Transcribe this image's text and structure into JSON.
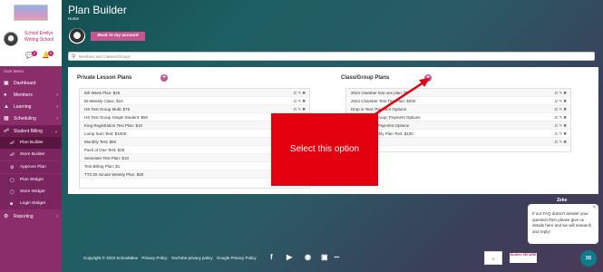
{
  "sidebar": {
    "school_name": "School Emilys Writing School",
    "messages_count": "0",
    "notifications_count": "0",
    "menu_label": "User Menu",
    "items": [
      {
        "label": "Dashboard",
        "icon": "dashboard-icon"
      },
      {
        "label": "Members",
        "icon": "users-icon"
      },
      {
        "label": "Learning",
        "icon": "graduation-cap-icon"
      },
      {
        "label": "Scheduling",
        "icon": "calendar-icon"
      },
      {
        "label": "Student Billing",
        "icon": "cart-icon"
      },
      {
        "label": "Reporting",
        "icon": "settings-icon"
      }
    ],
    "sub_items": [
      {
        "label": "Plan Builder"
      },
      {
        "label": "Store Builder"
      },
      {
        "label": "Approve Plan"
      },
      {
        "label": "Plan Widget"
      },
      {
        "label": "Store Widget"
      },
      {
        "label": "Login Widget"
      }
    ]
  },
  "header": {
    "title": "Plan Builder",
    "breadcrumb": "Home",
    "back_button": "Back to my account"
  },
  "search": {
    "placeholder": "Members and Classes/Groups"
  },
  "private": {
    "title": "Private Lesson Plans",
    "plans": [
      "5th Week Plan: $25",
      "Bi-Weekly Class: $10",
      "HS Test Group Multi: $75",
      "HS Test Group Single Student: $50",
      "King Registration Test Plan: $10",
      "Lump Sum Test: $1000",
      "Monthly Test: $50",
      "Pack of One Test: $25",
      "Semester Test Plan: $10",
      "Test Billing Plan: $1",
      "TT3 30 minute Weekly Plan: $30"
    ]
  },
  "group": {
    "title": "Class/Group Plans",
    "plans": [
      "2024 chamber test one plan: $5",
      "2024 Chamber Test Two Plan: $200",
      "Drop in Test: Payment Options",
      "Dropin Class Group: Payment Options",
      "Dropin Group: Payment Options",
      "Recurring Monthly Plan Test: $100",
      "PLAN: $100"
    ]
  },
  "overlay": {
    "label": "Select this option",
    "color": "#e3000f"
  },
  "footer": {
    "copyright": "Copyright © 2023 SchoolsBox",
    "privacy_policy": "Privacy Policy",
    "youtube_policy": "YouTube privacy policy",
    "google_policy": "Google Privacy Policy",
    "social": [
      "facebook-icon",
      "youtube-icon",
      "twitter-icon",
      "instagram-icon",
      "rss-icon"
    ],
    "trust_badge": "McAfee SECURE"
  },
  "chat": {
    "heading": "Zeke",
    "message": "If our FAQ doesn't answer your question then please give us details here and we will research and reply!"
  },
  "colors": {
    "accent": "#c6558f",
    "sidebar": "#8a2d6a"
  }
}
